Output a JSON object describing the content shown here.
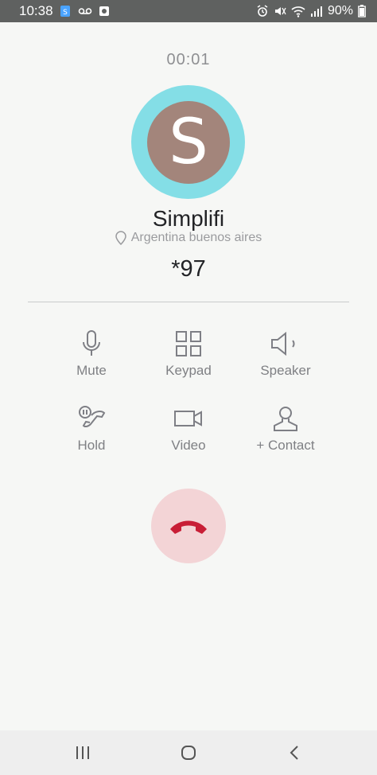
{
  "status_bar": {
    "time": "10:38",
    "battery": "90%"
  },
  "call": {
    "timer": "00:01",
    "avatar_letter": "S",
    "contact_name": "Simplifi",
    "location": "Argentina buenos aires",
    "number": "*97"
  },
  "controls": {
    "mute": "Mute",
    "keypad": "Keypad",
    "speaker": "Speaker",
    "hold": "Hold",
    "video": "Video",
    "add_contact": "+ Contact"
  },
  "colors": {
    "avatar_ring": "#84dee6",
    "avatar_bg": "#a3857b",
    "end_call_bg": "#f3d4d6",
    "end_call_icon": "#c81e36"
  },
  "icons": [
    "mute-icon",
    "keypad-icon",
    "speaker-icon",
    "hold-icon",
    "video-icon",
    "contact-icon",
    "end-call-icon"
  ]
}
